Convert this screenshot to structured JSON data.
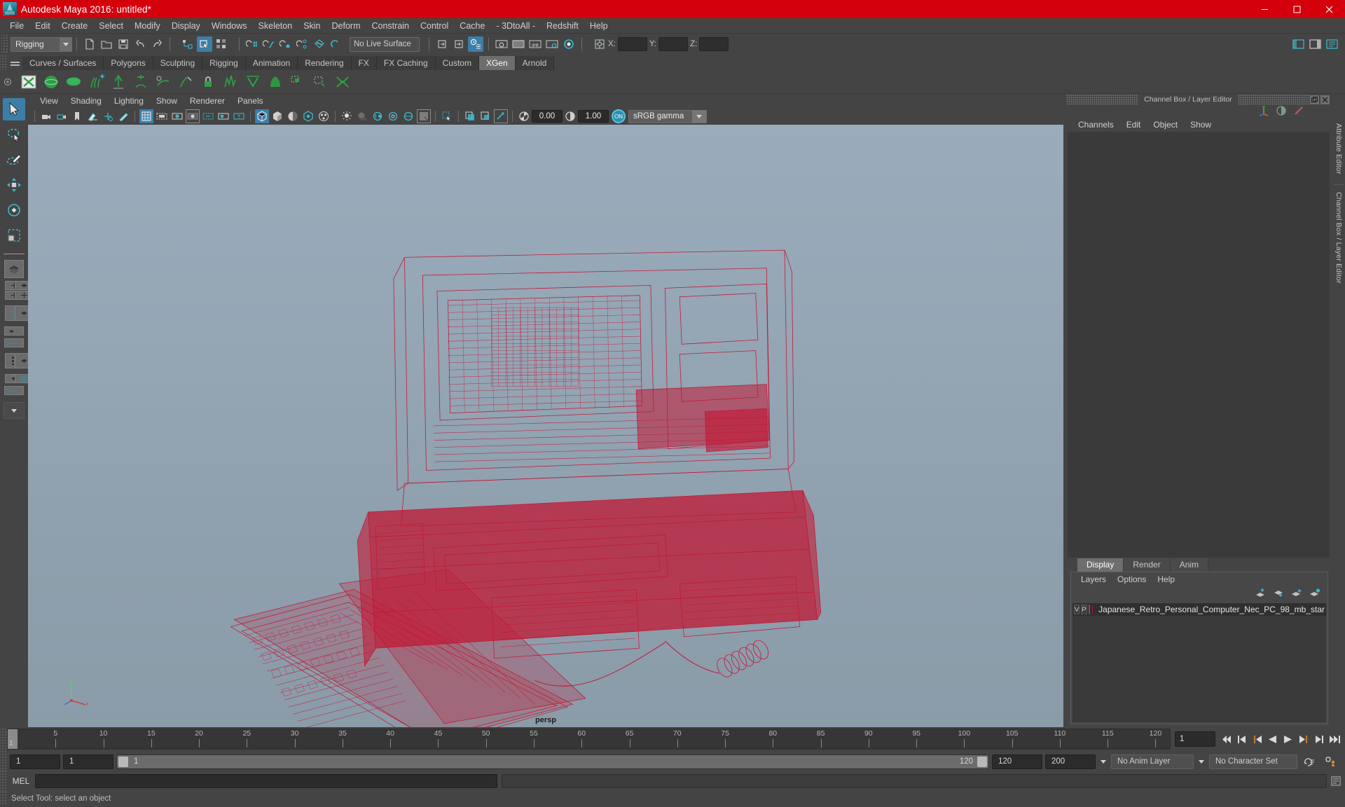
{
  "window": {
    "title": "Autodesk Maya 2016: untitled*",
    "logo_icon": "maya-logo-icon",
    "controls": [
      {
        "name": "minimize",
        "label": "—"
      },
      {
        "name": "maximize",
        "label": "☐"
      },
      {
        "name": "close",
        "label": "✕"
      }
    ]
  },
  "menubar": {
    "items": [
      "File",
      "Edit",
      "Create",
      "Select",
      "Modify",
      "Display",
      "Windows",
      "Skeleton",
      "Skin",
      "Deform",
      "Constrain",
      "Control",
      "Cache",
      "- 3DtoAll -",
      "Redshift",
      "Help"
    ]
  },
  "statusline": {
    "menu_set": "Rigging",
    "live_surface": "No Live Surface",
    "coord_labels": [
      "X:",
      "Y:",
      "Z:"
    ],
    "coord_values": [
      "",
      "",
      ""
    ],
    "icons": [
      "new-scene-icon",
      "open-scene-icon",
      "save-scene-icon",
      "undo-icon",
      "redo-icon",
      "select-by-hierarchy-icon",
      "select-by-object-icon",
      "select-by-component-icon",
      "snap-grid-icon",
      "snap-curve-icon",
      "snap-point-icon",
      "snap-projected-center-icon",
      "snap-view-plane-icon",
      "make-live-icon",
      "input-connections-icon",
      "output-connections-icon",
      "construction-history-icon",
      "render-current-frame-icon",
      "ipr-render-icon",
      "render-settings-icon",
      "hypershade-icon",
      "show-hide-editors-icon",
      "channel-box-toggle-icon",
      "attribute-editor-toggle-icon"
    ]
  },
  "shelf": {
    "tabs": [
      "Curves / Surfaces",
      "Polygons",
      "Sculpting",
      "Rigging",
      "Animation",
      "Rendering",
      "FX",
      "FX Caching",
      "Custom",
      "XGen",
      "Arnold"
    ],
    "selected_tab": "XGen",
    "icons": [
      "xgen-window-icon",
      "sphere-primitive-icon",
      "disc-primitive-icon",
      "add-grooming-icon",
      "create-description-icon",
      "add-guide-icon",
      "comb-brush-icon",
      "cut-brush-icon",
      "lock-brush-icon",
      "noise-brush-icon",
      "density-brush-icon",
      "part-brush-icon",
      "clump-modifier-icon",
      "mask-modifier-icon",
      "convert-primitives-icon"
    ]
  },
  "toolbox": {
    "tools": [
      {
        "name": "select-tool",
        "selected": true
      },
      {
        "name": "lasso-select-tool",
        "selected": false
      },
      {
        "name": "paint-select-tool",
        "selected": false
      },
      {
        "name": "move-tool",
        "selected": false
      },
      {
        "name": "rotate-tool",
        "selected": false
      },
      {
        "name": "scale-tool",
        "selected": false
      }
    ],
    "layouts": [
      "single-perspective-layout",
      "four-view-layout",
      "two-pane-layout",
      "outliner-persp-layout",
      "hypergraph-layout",
      "persp-graph-layout",
      "outliner-graph-layout",
      "more-layouts"
    ]
  },
  "viewport": {
    "menus": [
      "View",
      "Shading",
      "Lighting",
      "Show",
      "Renderer",
      "Panels"
    ],
    "camera_label": "persp",
    "exposure": "0.00",
    "gamma": "1.00",
    "color_management_toggle": "ON",
    "color_profile": "sRGB gamma",
    "toolbar_icons": [
      "select-camera-icon",
      "camera-attributes-icon",
      "bookmark-icon",
      "image-plane-icon",
      "two-d-pan-zoom-icon",
      "grease-pencil-icon",
      "grid-toggle-icon",
      "film-gate-icon",
      "resolution-gate-icon",
      "gate-mask-icon",
      "field-chart-icon",
      "safe-action-icon",
      "safe-title-icon",
      "wireframe-shading-icon",
      "smooth-shade-all-icon",
      "smooth-shade-selected-icon",
      "flat-shade-icon",
      "bounding-box-icon",
      "use-default-light-icon",
      "shadows-icon",
      "screen-space-ao-icon",
      "motion-blur-icon",
      "anti-alias-icon",
      "multisample-icon",
      "xray-icon",
      "xray-joints-icon",
      "xray-active-components-icon",
      "isolate-select-icon",
      "exposure-icon",
      "gamma-icon"
    ],
    "model": {
      "name": "Japanese_Retro_Personal_Computer_Nec_PC_98",
      "wireframe_color": "#c4122f",
      "background_top": "#9aabbb",
      "background_bottom": "#8b9ca9"
    }
  },
  "channel_box": {
    "panel_title": "Channel Box / Layer Editor",
    "menus": [
      "Channels",
      "Edit",
      "Object",
      "Show"
    ],
    "header_icons": [
      "transform-channels-icon",
      "output-channels-icon",
      "shape-channels-icon"
    ]
  },
  "layer_editor": {
    "tabs": [
      "Display",
      "Render",
      "Anim"
    ],
    "selected_tab": "Display",
    "menus": [
      "Layers",
      "Options",
      "Help"
    ],
    "tool_icons": [
      "move-layer-up-icon",
      "move-layer-down-icon",
      "new-layer-icon",
      "new-layer-from-selected-icon"
    ],
    "layers": [
      {
        "visibility": "V",
        "playback": "P",
        "reference": "",
        "color": "#c4122f",
        "name": "Japanese_Retro_Personal_Computer_Nec_PC_98_mb_star"
      }
    ]
  },
  "vertical_tabs": [
    "Attribute Editor",
    "Channel Box / Layer Editor"
  ],
  "timeline": {
    "start": 1,
    "end": 120,
    "current_frame": "1",
    "tick_labels": [
      "5",
      "10",
      "15",
      "20",
      "25",
      "30",
      "35",
      "40",
      "45",
      "50",
      "55",
      "60",
      "65",
      "70",
      "75",
      "80",
      "85",
      "90",
      "95",
      "100",
      "105",
      "110",
      "115",
      "120"
    ],
    "current_frame_field": "1",
    "playback_buttons": [
      "go-to-start-icon",
      "step-back-keyframe-icon",
      "step-back-frame-icon",
      "play-backwards-icon",
      "play-forwards-icon",
      "step-forward-frame-icon",
      "step-forward-keyframe-icon",
      "go-to-end-icon"
    ]
  },
  "range_slider": {
    "anim_start": "1",
    "range_start": "1",
    "bar_start_value": "1",
    "bar_end_value": "120",
    "range_end": "120",
    "anim_end": "200",
    "anim_layer": "No Anim Layer",
    "character_set": "No Character Set",
    "auto_key_icon": "auto-keyframe-icon",
    "prefs_icon": "animation-preferences-icon"
  },
  "command_line": {
    "language": "MEL",
    "input_value": "",
    "output_value": "",
    "script_editor_icon": "script-editor-icon"
  },
  "help_line": {
    "text": "Select Tool: select an object"
  }
}
